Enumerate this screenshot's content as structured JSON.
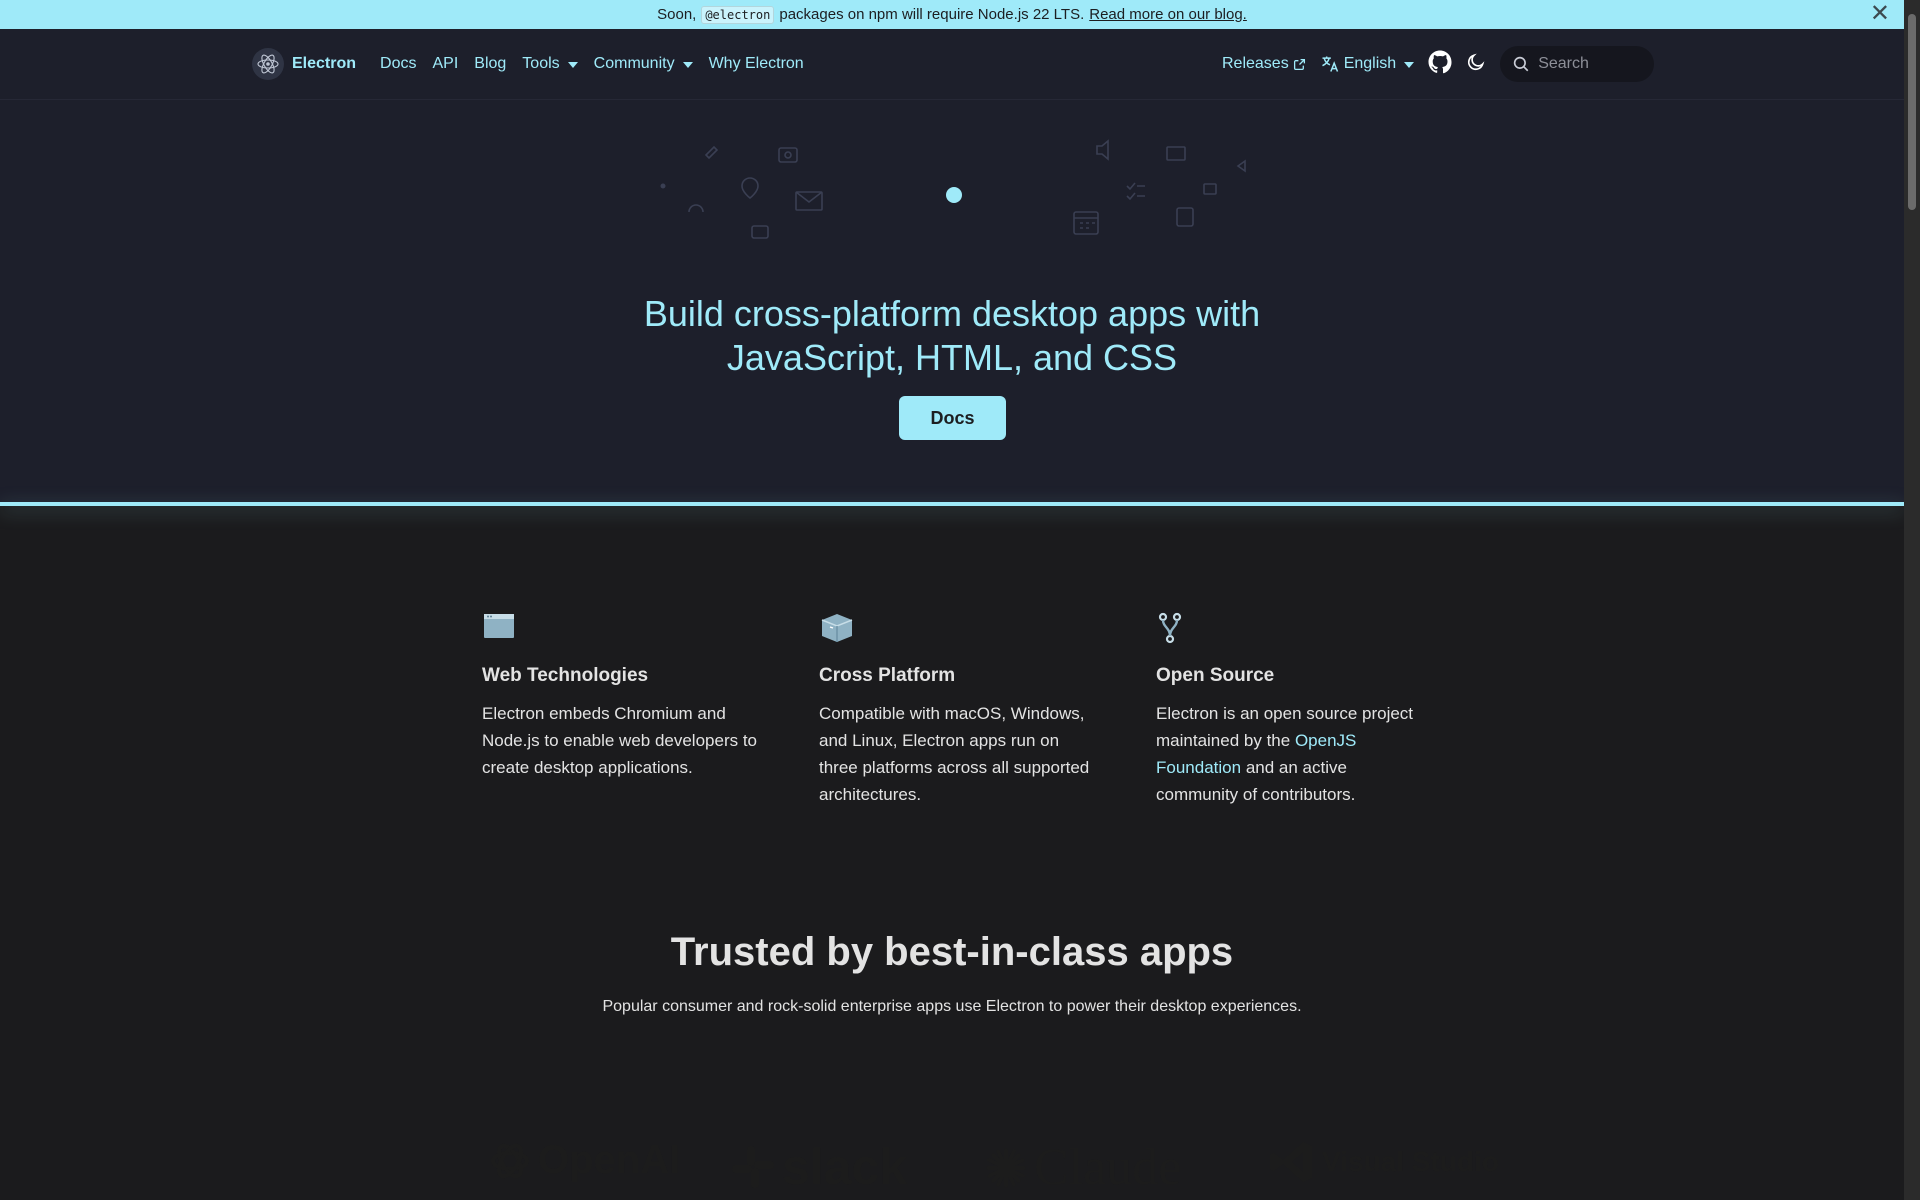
{
  "announcement": {
    "prefix": "Soon,",
    "code": "@electron",
    "suffix": "packages on npm will require Node.js 22 LTS.",
    "link": "Read more on our blog.",
    "close_glyph": "✕"
  },
  "navbar": {
    "brand": "Electron",
    "links": [
      "Docs",
      "API",
      "Blog",
      "Tools",
      "Community",
      "Why Electron"
    ],
    "releases": "Releases",
    "language": "English",
    "search_placeholder": "Search"
  },
  "hero": {
    "title_line1": "Build cross-platform desktop apps with",
    "title_line2": "JavaScript, HTML, and CSS",
    "button": "Docs"
  },
  "features": [
    {
      "title": "Web Technologies",
      "text": "Electron embeds Chromium and Node.js to enable web developers to create desktop applications."
    },
    {
      "title": "Cross Platform",
      "text": "Compatible with macOS, Windows, and Linux, Electron apps run on three platforms across all supported architectures."
    },
    {
      "title": "Open Source",
      "text_before": "Electron is an open source project maintained by the",
      "link": "OpenJS Foundation",
      "text_after": "and an active community of contributors."
    }
  ],
  "trusted": {
    "title": "Trusted by best-in-class apps",
    "subtitle": "Popular consumer and rock-solid enterprise apps use Electron to power their desktop experiences."
  },
  "logos": [
    "OpenAI",
    "slack",
    "Claude",
    "Visual Studio C"
  ],
  "colors": {
    "accent": "#9feaf9",
    "nav_bg": "#1d1f2b",
    "page_bg": "#1b1b1d",
    "text": "#e3e3e3"
  }
}
